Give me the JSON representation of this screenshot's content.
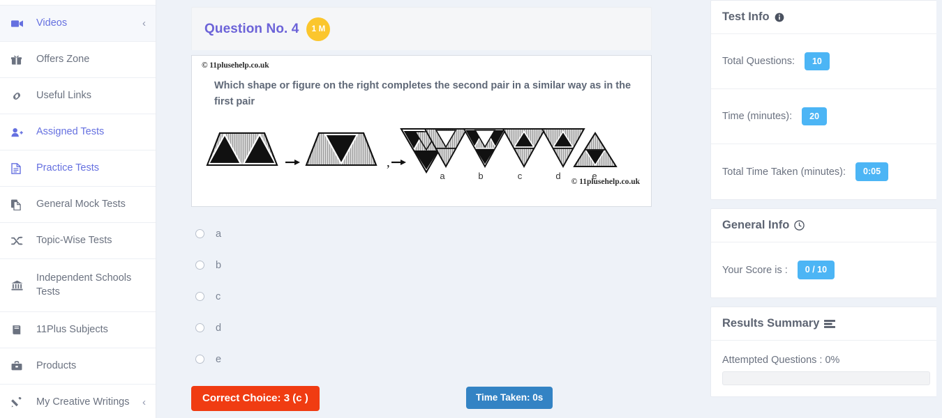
{
  "sidebar": {
    "items": [
      {
        "label": "Videos",
        "icon": "video-camera-icon",
        "style": "purple",
        "active": true,
        "chevron": "‹"
      },
      {
        "label": "Offers Zone",
        "icon": "gift-icon",
        "style": "grey",
        "active": false,
        "chevron": ""
      },
      {
        "label": "Useful Links",
        "icon": "link-icon",
        "style": "grey",
        "active": false,
        "chevron": ""
      },
      {
        "label": "Assigned Tests",
        "icon": "user-plus-icon",
        "style": "purple",
        "active": false,
        "chevron": ""
      },
      {
        "label": "Practice Tests",
        "icon": "file-text-icon",
        "style": "purple",
        "active": false,
        "chevron": ""
      },
      {
        "label": "General Mock Tests",
        "icon": "copy-icon",
        "style": "grey",
        "active": false,
        "chevron": ""
      },
      {
        "label": "Topic-Wise Tests",
        "icon": "shuffle-icon",
        "style": "grey",
        "active": false,
        "chevron": ""
      },
      {
        "label": "Independent Schools Tests",
        "icon": "bank-icon",
        "style": "grey",
        "active": false,
        "chevron": ""
      },
      {
        "label": "11Plus Subjects",
        "icon": "book-icon",
        "style": "grey",
        "active": false,
        "chevron": ""
      },
      {
        "label": "Products",
        "icon": "briefcase-icon",
        "style": "grey",
        "active": false,
        "chevron": ""
      },
      {
        "label": "My Creative Writings",
        "icon": "pencil-icon",
        "style": "grey",
        "active": false,
        "chevron": "‹"
      }
    ]
  },
  "question": {
    "title": "Question No. 4",
    "marks_badge": "1 M",
    "copyright_top": "© 11plusehelp.co.uk",
    "copyright_bottom": "© 11plusehelp.co.uk",
    "prompt": "Which shape or figure on the right completes the second pair in a similar way as in the first pair",
    "figure_labels": [
      "a",
      "b",
      "c",
      "d",
      "e"
    ],
    "options": [
      {
        "value": "a",
        "label": "a",
        "checked": false
      },
      {
        "value": "b",
        "label": "b",
        "checked": false
      },
      {
        "value": "c",
        "label": "c",
        "checked": false
      },
      {
        "value": "d",
        "label": "d",
        "checked": false
      },
      {
        "value": "e",
        "label": "e",
        "checked": false
      }
    ],
    "correct_choice_label": "Correct Choice: 3 (c )",
    "time_taken_label": "Time Taken: 0s",
    "correct_choice_color": "#f03c12",
    "time_taken_color": "#3383c4"
  },
  "test_info": {
    "title": "Test Info",
    "icon": "info-circle-icon",
    "rows": [
      {
        "label": "Total Questions:",
        "value": "10"
      },
      {
        "label": "Time (minutes):",
        "value": "20"
      },
      {
        "label": "Total Time Taken (minutes):",
        "value": "0:05"
      }
    ]
  },
  "general_info": {
    "title": "General Info",
    "icon": "clock-icon",
    "rows": [
      {
        "label": "Your Score is :",
        "value": "0 / 10"
      }
    ]
  },
  "results_summary": {
    "title": "Results Summary",
    "icon": "list-icon",
    "attempted_label": "Attempted Questions : 0%",
    "attempted_percent": 0
  },
  "theme": {
    "accent_purple": "#6c63d8",
    "badge_yellow": "#fbc62d",
    "pill_blue": "#4cb5f5",
    "page_bg": "#eef2f8"
  }
}
